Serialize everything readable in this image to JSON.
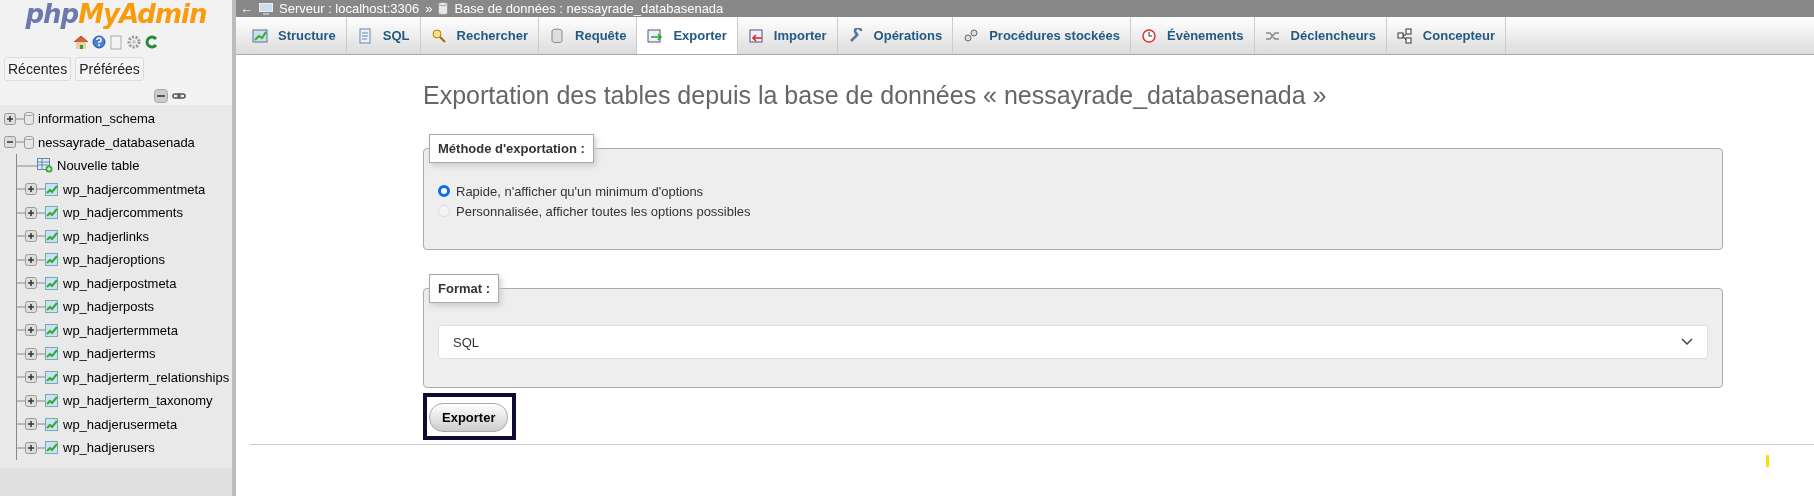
{
  "sidebar": {
    "logo": {
      "part_1": "php",
      "part_2": "MyAdmin"
    },
    "buttons": [
      "Récentes",
      "Préférées"
    ],
    "tree": [
      {
        "label": "information_schema",
        "kind": "database",
        "expanded": false
      },
      {
        "label": "nessayrade_databasenada",
        "kind": "database",
        "expanded": true,
        "children": [
          {
            "label": "Nouvelle table",
            "kind": "new"
          },
          {
            "label": "wp_hadjercommentmeta",
            "kind": "table",
            "expanded": false
          },
          {
            "label": "wp_hadjercomments",
            "kind": "table",
            "expanded": false
          },
          {
            "label": "wp_hadjerlinks",
            "kind": "table",
            "expanded": false
          },
          {
            "label": "wp_hadjeroptions",
            "kind": "table",
            "expanded": false
          },
          {
            "label": "wp_hadjerpostmeta",
            "kind": "table",
            "expanded": false
          },
          {
            "label": "wp_hadjerposts",
            "kind": "table",
            "expanded": false
          },
          {
            "label": "wp_hadjertermmeta",
            "kind": "table",
            "expanded": false
          },
          {
            "label": "wp_hadjerterms",
            "kind": "table",
            "expanded": false
          },
          {
            "label": "wp_hadjerterm_relationships",
            "kind": "table",
            "expanded": false
          },
          {
            "label": "wp_hadjerterm_taxonomy",
            "kind": "table",
            "expanded": false
          },
          {
            "label": "wp_hadjerusermeta",
            "kind": "table",
            "expanded": false
          },
          {
            "label": "wp_hadjerusers",
            "kind": "table",
            "expanded": false
          }
        ]
      }
    ]
  },
  "breadcrumb": {
    "back": "←",
    "server": "Serveur : localhost:3306",
    "separator": "»",
    "database": "Base de données : nessayrade_databasenada"
  },
  "tabs": [
    {
      "label": "Structure",
      "selected": false
    },
    {
      "label": "SQL",
      "selected": false
    },
    {
      "label": "Rechercher",
      "selected": false
    },
    {
      "label": "Requête",
      "selected": false
    },
    {
      "label": "Exporter",
      "selected": true
    },
    {
      "label": "Importer",
      "selected": false
    },
    {
      "label": "Opérations",
      "selected": false
    },
    {
      "label": "Procédures stockées",
      "selected": false
    },
    {
      "label": "Évènements",
      "selected": false
    },
    {
      "label": "Déclencheurs",
      "selected": false
    },
    {
      "label": "Concepteur",
      "selected": false
    }
  ],
  "title": "Exportation des tables depuis la base de données « nessayrade_databasenada »",
  "export_method": {
    "legend": "Méthode d'exportation :",
    "options": [
      {
        "label": "Rapide, n'afficher qu'un minimum d'options",
        "selected": true
      },
      {
        "label": "Personnalisée, afficher toutes les options possibles",
        "selected": false
      }
    ]
  },
  "format": {
    "legend": "Format :",
    "value": "SQL"
  },
  "export_button": "Exporter"
}
